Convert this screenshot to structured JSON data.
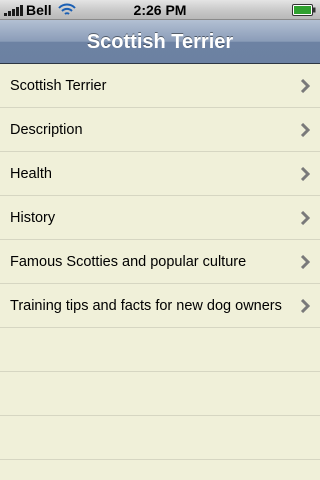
{
  "statusbar": {
    "carrier": "Bell",
    "time": "2:26 PM",
    "icons": [
      "signal-icon",
      "wifi-icon",
      "battery-icon"
    ]
  },
  "navbar": {
    "title": "Scottish Terrier"
  },
  "list": {
    "items": [
      {
        "label": "Scottish Terrier"
      },
      {
        "label": "Description"
      },
      {
        "label": "Health"
      },
      {
        "label": "History"
      },
      {
        "label": "Famous Scotties and popular culture"
      },
      {
        "label": "Training tips and facts for new dog owners"
      }
    ],
    "empty_rows": 3,
    "chevron_icon": "chevron-right-icon"
  },
  "colors": {
    "background": "#f0f0d9",
    "navbar": "#6d82a3",
    "separator": "#d6d6c2",
    "chevron": "#7a7a7a"
  }
}
